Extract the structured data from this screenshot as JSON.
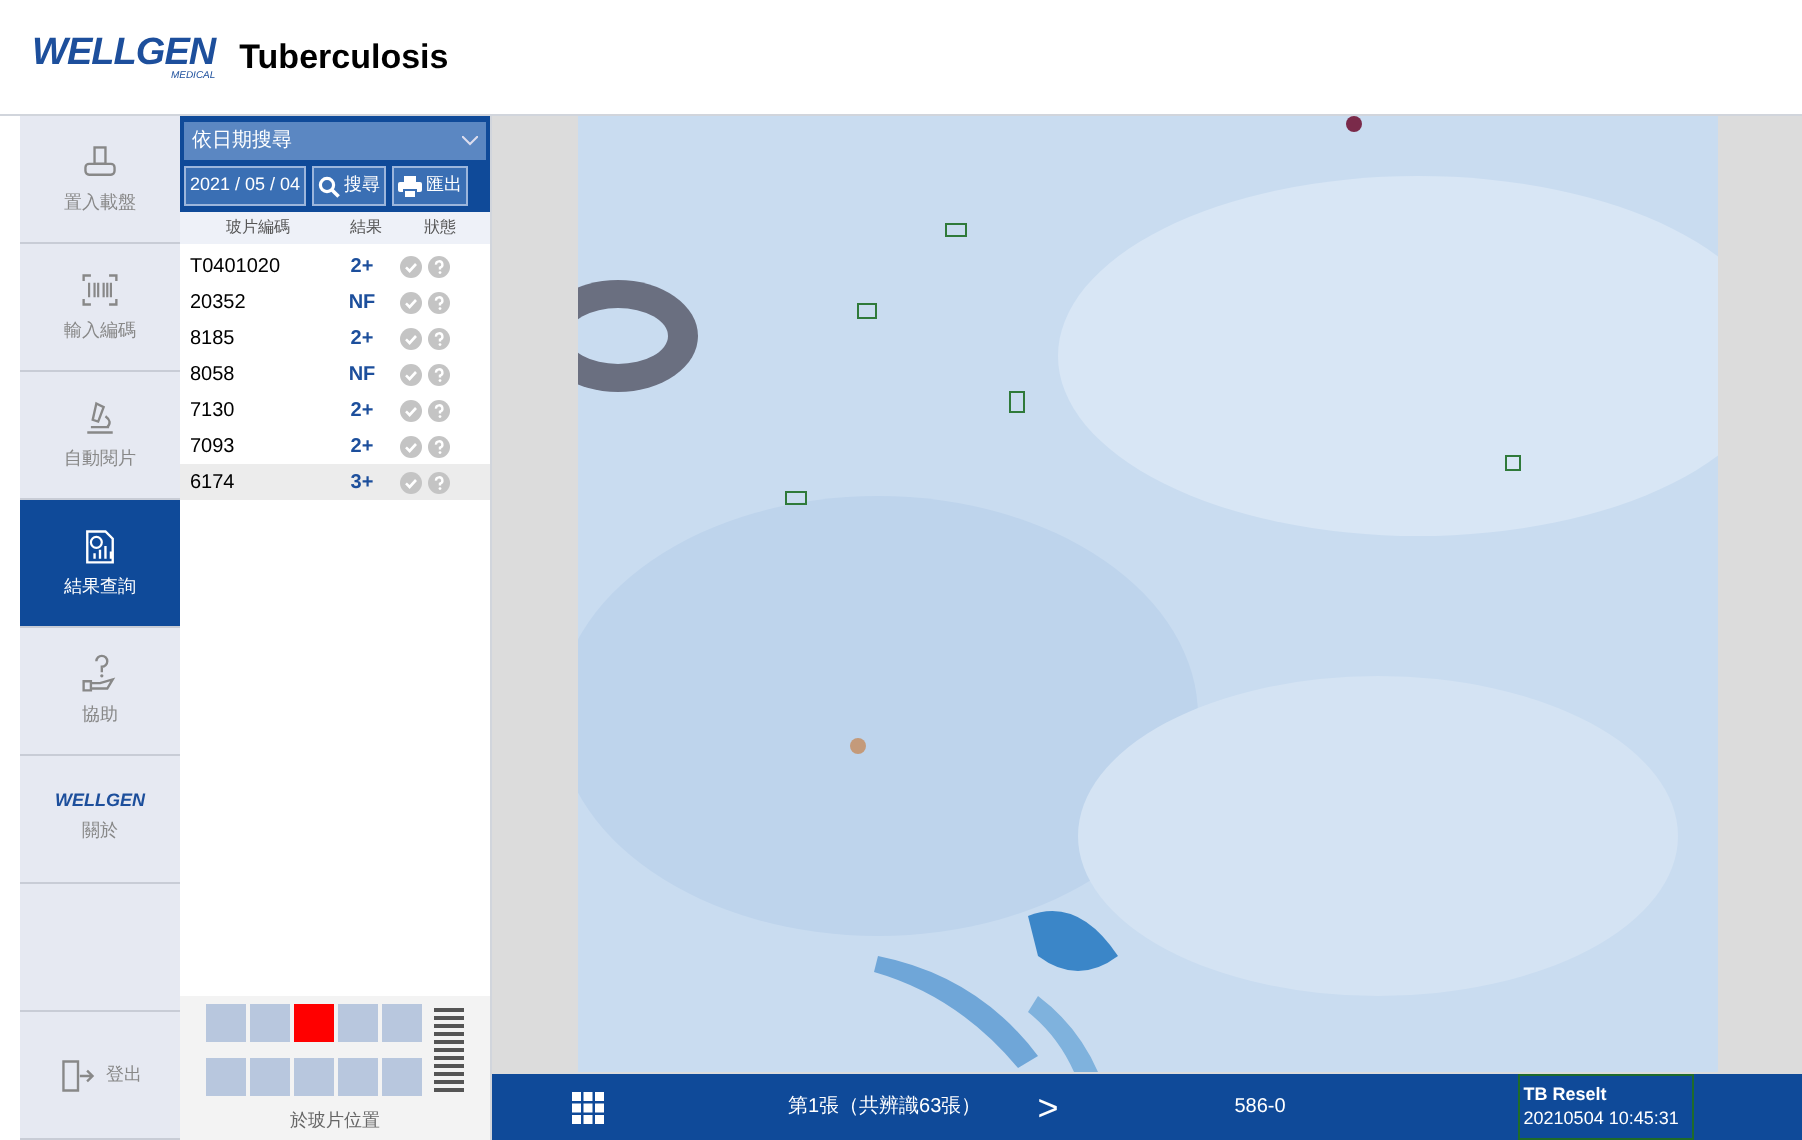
{
  "header": {
    "logo": "WELLGEN",
    "logo_sub": "MEDICAL",
    "title": "Tuberculosis"
  },
  "sidebar": {
    "items": [
      {
        "kind": "tray",
        "label": "置入載盤",
        "selected": false
      },
      {
        "kind": "barcode",
        "label": "輸入編碼",
        "selected": false
      },
      {
        "kind": "microscope",
        "label": "自動閱片",
        "selected": false
      },
      {
        "kind": "report",
        "label": "結果查詢",
        "selected": true
      },
      {
        "kind": "help",
        "label": "協助",
        "selected": false
      },
      {
        "kind": "logo",
        "logo": "WELLGEN",
        "label": "關於",
        "selected": false
      },
      {
        "kind": "empty"
      },
      {
        "kind": "logout",
        "label": "登出",
        "selected": false
      }
    ]
  },
  "search": {
    "mode": "依日期搜尋",
    "date": "2021 / 05 / 04",
    "search_button": "搜尋",
    "export_button": "匯出"
  },
  "table": {
    "columns": [
      "玻片編碼",
      "結果",
      "狀態"
    ],
    "rows": [
      {
        "id": "T0401020",
        "result": "2+",
        "selected": false
      },
      {
        "id": "20352",
        "result": "NF",
        "selected": false
      },
      {
        "id": "8185",
        "result": "2+",
        "selected": false
      },
      {
        "id": "8058",
        "result": "NF",
        "selected": false
      },
      {
        "id": "7130",
        "result": "2+",
        "selected": false
      },
      {
        "id": "7093",
        "result": "2+",
        "selected": false
      },
      {
        "id": "6174",
        "result": "3+",
        "selected": true
      }
    ]
  },
  "slide_position": {
    "label": "於玻片位置",
    "fields": [
      {
        "selected": false
      },
      {
        "selected": false
      },
      {
        "selected": true
      },
      {
        "selected": false
      },
      {
        "selected": false
      },
      {
        "selected": false
      },
      {
        "selected": false
      },
      {
        "selected": false
      },
      {
        "selected": false
      },
      {
        "selected": false
      }
    ]
  },
  "footer": {
    "counter": "第1張（共辨識63張）",
    "next": ">",
    "field_id": "586-0",
    "result_title": "TB Reselt",
    "timestamp": "20210504 10:45:31"
  }
}
